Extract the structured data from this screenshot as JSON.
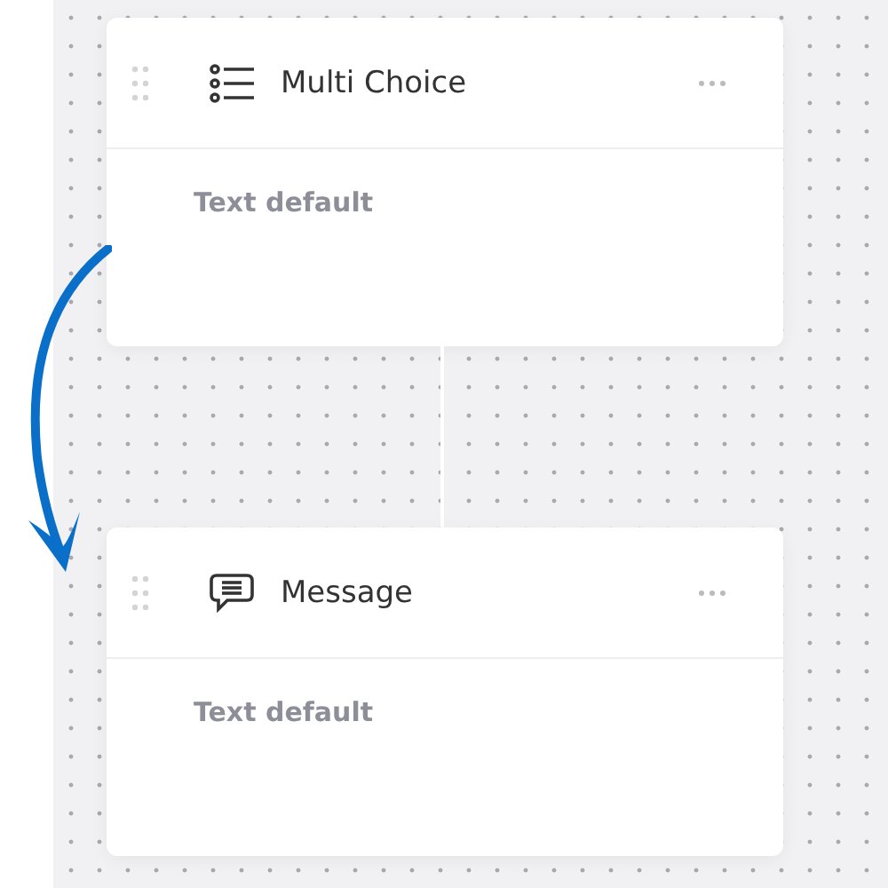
{
  "nodes": [
    {
      "kind": "multi_choice",
      "title": "Multi Choice",
      "body": "Text default"
    },
    {
      "kind": "message",
      "title": "Message",
      "body": "Text default"
    }
  ]
}
